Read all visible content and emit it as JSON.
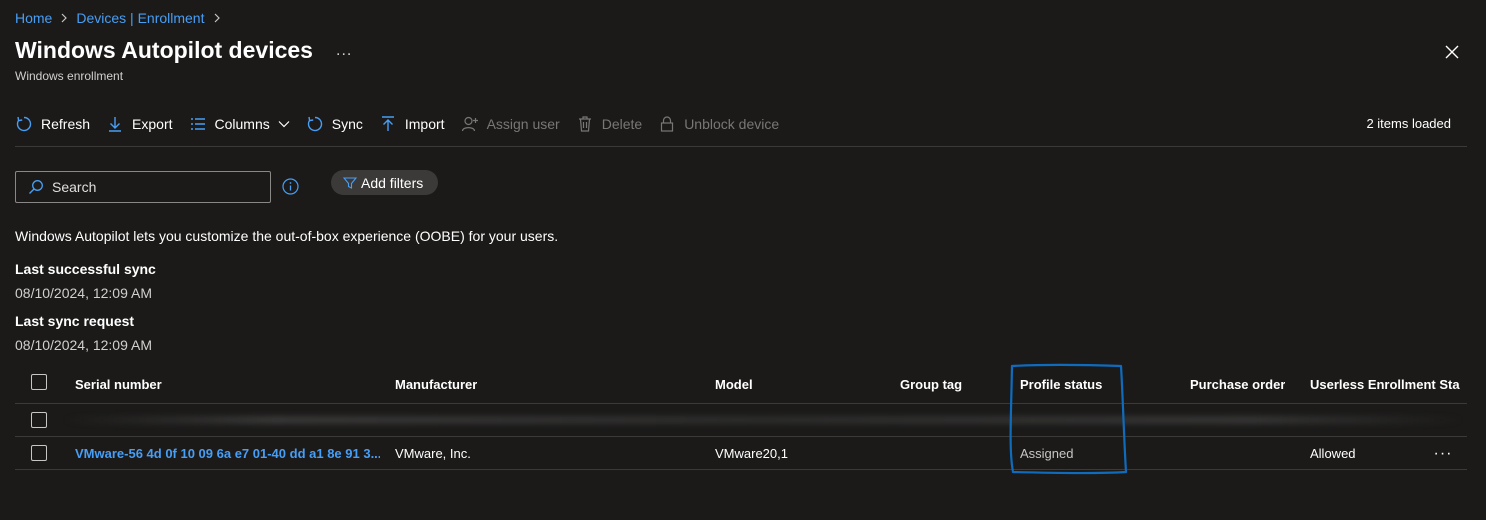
{
  "breadcrumb": {
    "items": [
      "Home",
      "Devices | Enrollment"
    ]
  },
  "page": {
    "title": "Windows Autopilot devices",
    "subtitle": "Windows enrollment",
    "more": "..."
  },
  "toolbar": {
    "refresh": "Refresh",
    "export": "Export",
    "columns": "Columns",
    "sync": "Sync",
    "import": "Import",
    "assign_user": "Assign user",
    "delete": "Delete",
    "unblock_device": "Unblock device",
    "items_loaded": "2 items loaded"
  },
  "search": {
    "placeholder": "Search"
  },
  "filters": {
    "add_filters": "Add filters"
  },
  "info": {
    "intro": "Windows Autopilot lets you customize the out-of-box experience (OOBE) for your users.",
    "last_successful_sync_label": "Last successful sync",
    "last_successful_sync_value": "08/10/2024, 12:09 AM",
    "last_sync_request_label": "Last sync request",
    "last_sync_request_value": "08/10/2024, 12:09 AM"
  },
  "table": {
    "columns": {
      "serial": "Serial number",
      "manufacturer": "Manufacturer",
      "model": "Model",
      "group_tag": "Group tag",
      "profile_status": "Profile status",
      "purchase_order": "Purchase order",
      "userless": "Userless Enrollment Sta..."
    },
    "rows": [
      {
        "serial": "",
        "manufacturer": "",
        "model": "",
        "group_tag": "",
        "profile_status": "",
        "purchase_order": "",
        "userless": ""
      },
      {
        "serial": "VMware-56 4d 0f 10 09 6a e7 01-40 dd a1 8e 91 3...",
        "manufacturer": "VMware, Inc.",
        "model": "VMware20,1",
        "group_tag": "",
        "profile_status": "Assigned",
        "purchase_order": "",
        "userless": "Allowed"
      }
    ],
    "row_more": "···"
  },
  "colors": {
    "background": "#1b1a19",
    "link": "#479ef5",
    "highlight": "#0f6cbd",
    "disabled": "#797775"
  }
}
